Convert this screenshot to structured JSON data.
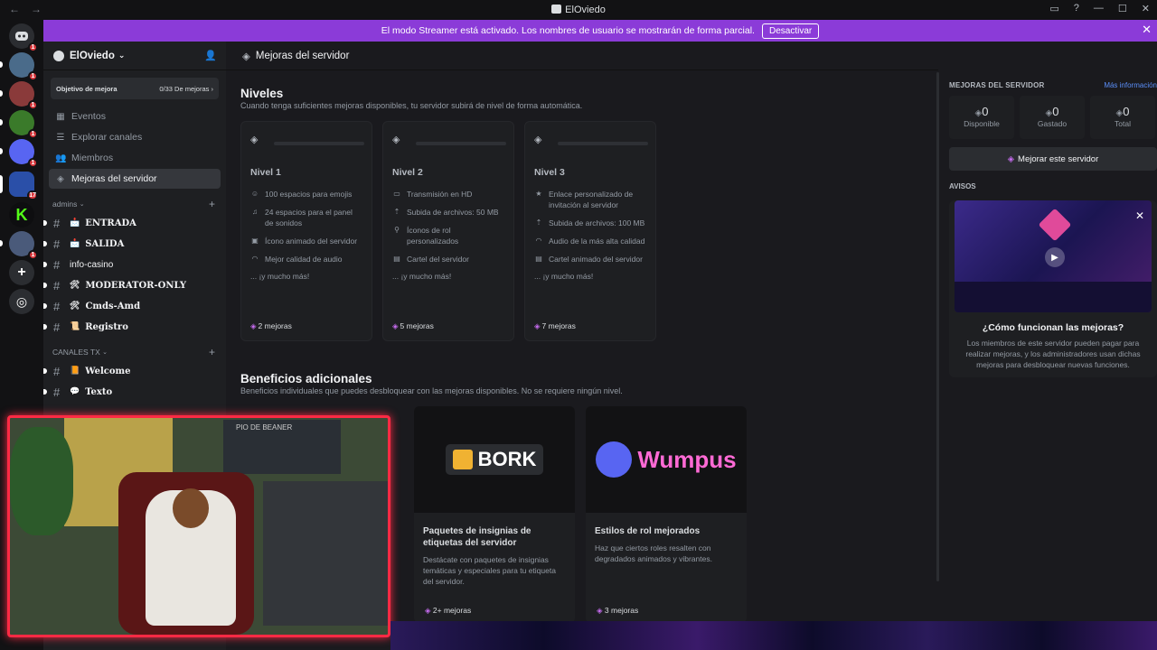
{
  "window": {
    "title": "ElOviedo",
    "nav_back": "←",
    "nav_fwd": "→"
  },
  "banner": {
    "text": "El modo Streamer está activado. Los nombres de usuario se mostrarán de forma parcial.",
    "button": "Desactivar",
    "close": "✕"
  },
  "guilds": {
    "badges": [
      "1",
      "1",
      "1",
      "1",
      "1",
      "17",
      "1",
      "1"
    ]
  },
  "server": {
    "name": "ElOviedo",
    "chevron": "⌄"
  },
  "goal": {
    "label": "Objetivo de mejora",
    "progress": "0/33 De mejoras",
    "arrow": "›"
  },
  "nav": [
    {
      "label": "Eventos",
      "icon": "calendar-icon"
    },
    {
      "label": "Explorar canales",
      "icon": "browse-icon"
    },
    {
      "label": "Miembros",
      "icon": "members-icon"
    },
    {
      "label": "Mejoras del servidor",
      "icon": "boost-icon"
    }
  ],
  "categories": [
    {
      "name": "admins",
      "channels": [
        {
          "emoji": "📩",
          "name": "ENTRADA"
        },
        {
          "emoji": "📩",
          "name": "SALIDA"
        },
        {
          "emoji": "",
          "name": "info-casino"
        },
        {
          "emoji": "🛠",
          "name": "MODERATOR-ONLY"
        },
        {
          "emoji": "🛠",
          "name": "Cmds-Amd"
        },
        {
          "emoji": "📜",
          "name": "Registro"
        }
      ]
    },
    {
      "name": "CANALES TX",
      "channels": [
        {
          "emoji": "📙",
          "name": "Welcome"
        },
        {
          "emoji": "💬",
          "name": "Texto"
        }
      ]
    }
  ],
  "page": {
    "title": "Mejoras del servidor"
  },
  "niveles": {
    "title": "Niveles",
    "subtitle": "Cuando tenga suficientes mejoras disponibles, tu servidor subirá de nivel de forma automática.",
    "tiers": [
      {
        "name": "Nivel 1",
        "perks": [
          "100 espacios para emojis",
          "24 espacios para el panel de sonidos",
          "Ícono animado del servidor",
          "Mejor calidad de audio"
        ],
        "more": "... ¡y mucho más!",
        "count": "2 mejoras"
      },
      {
        "name": "Nivel 2",
        "perks": [
          "Transmisión en HD",
          "Subida de archivos: 50 MB",
          "Íconos de rol personalizados",
          "Cartel del servidor"
        ],
        "more": "... ¡y mucho más!",
        "count": "5 mejoras"
      },
      {
        "name": "Nivel 3",
        "perks": [
          "Enlace personalizado de invitación al servidor",
          "Subida de archivos: 100 MB",
          "Audio de la más alta calidad",
          "Cartel animado del servidor"
        ],
        "more": "... ¡y mucho más!",
        "count": "7 mejoras"
      }
    ]
  },
  "beneficios": {
    "title": "Beneficios adicionales",
    "subtitle": "Beneficios individuales que puedes desbloquear con las mejoras disponibles. No se requiere ningún nivel.",
    "perks": [
      {
        "art": "BORK",
        "title": "Paquetes de insignias de etiquetas del servidor",
        "desc": "Destácate con paquetes de insignias temáticas y especiales para tu etiqueta del servidor.",
        "count": "2+ mejoras"
      },
      {
        "art": "Wumpus",
        "title": "Estilos de rol mejorados",
        "desc": "Haz que ciertos roles resalten con degradados animados y vibrantes.",
        "count": "3 mejoras"
      }
    ]
  },
  "right": {
    "title": "MEJORAS DEL SERVIDOR",
    "link": "Más información",
    "stats": [
      {
        "num": "0",
        "label": "Disponible"
      },
      {
        "num": "0",
        "label": "Gastado"
      },
      {
        "num": "0",
        "label": "Total"
      }
    ],
    "boost_button": "Mejorar este servidor",
    "avisos": "AVISOS",
    "card_title": "¿Cómo funcionan las mejoras?",
    "card_desc": "Los miembros de este servidor pueden pagar para realizar mejoras, y los administradores usan dichas mejoras para desbloquear nuevas funciones.",
    "card_close": "✕"
  },
  "webcam": {
    "sign": "PIO DE BEANER"
  },
  "colors": {
    "accent": "#8b3bd8",
    "boost": "#c76cf0",
    "webcam_border": "#ff2a44"
  }
}
